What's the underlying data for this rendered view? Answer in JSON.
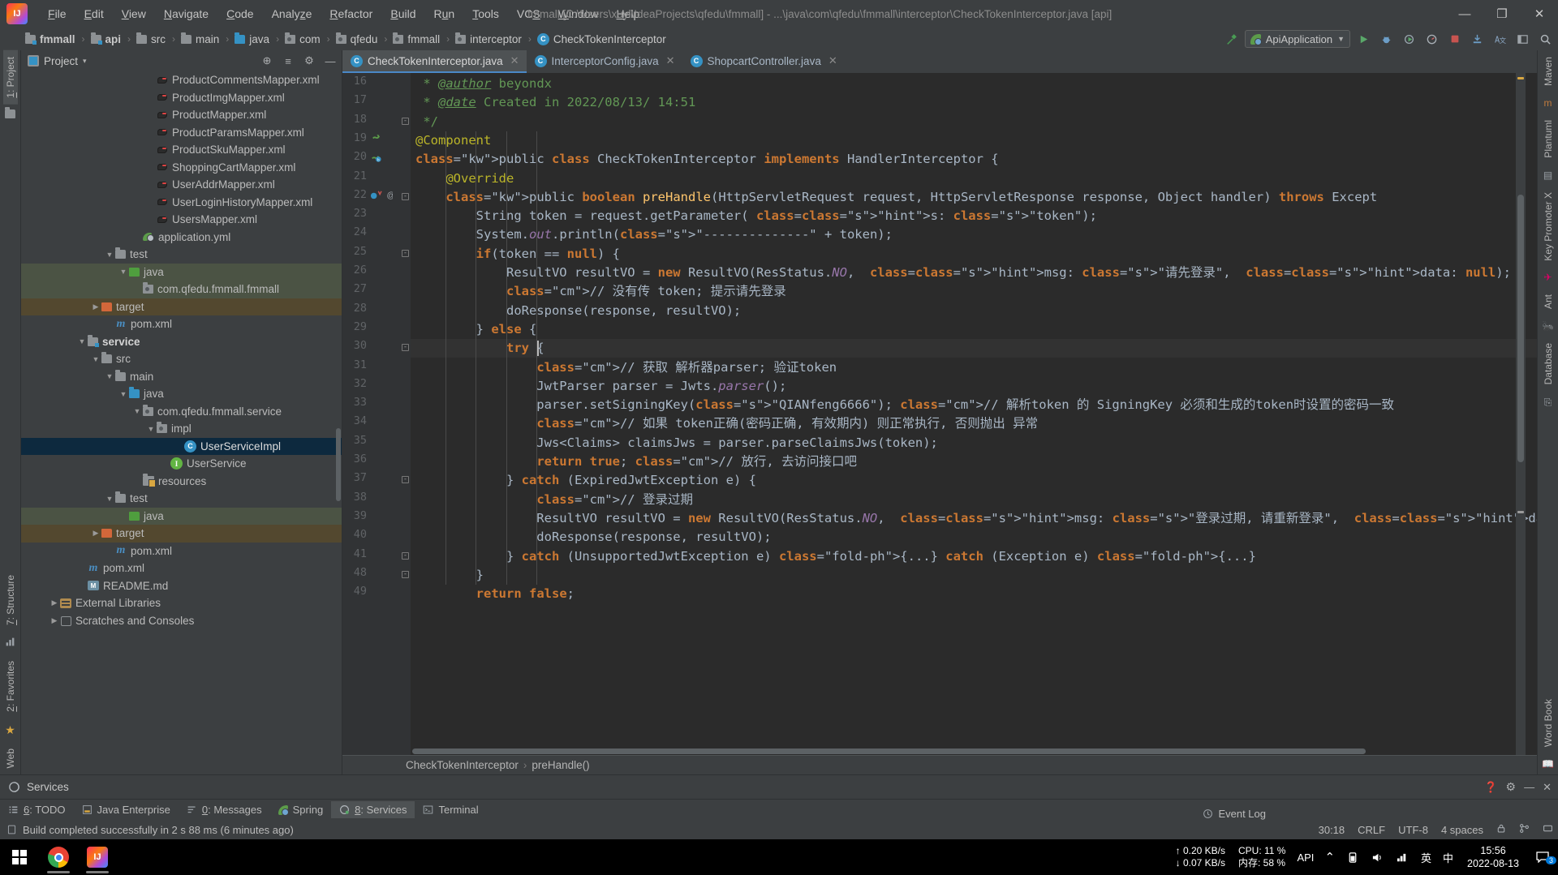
{
  "window": {
    "title": "fmmall [C:\\Users\\xuyl\\IdeaProjects\\qfedu\\fmmall] - ...\\java\\com\\qfedu\\fmmall\\interceptor\\CheckTokenInterceptor.java [api]",
    "minimize": "—",
    "maximize": "❐",
    "close": "✕"
  },
  "menu": {
    "items": [
      "File",
      "Edit",
      "View",
      "Navigate",
      "Code",
      "Analyze",
      "Refactor",
      "Build",
      "Run",
      "Tools",
      "VCS",
      "Window",
      "Help"
    ]
  },
  "navbar": {
    "crumbs": [
      {
        "label": "fmmall",
        "icon": "module-folder-icon",
        "bold": true
      },
      {
        "label": "api",
        "icon": "module-folder-icon",
        "bold": true
      },
      {
        "label": "src",
        "icon": "folder-icon"
      },
      {
        "label": "main",
        "icon": "folder-icon"
      },
      {
        "label": "java",
        "icon": "source-folder-icon"
      },
      {
        "label": "com",
        "icon": "package-icon"
      },
      {
        "label": "qfedu",
        "icon": "package-icon"
      },
      {
        "label": "fmmall",
        "icon": "package-icon"
      },
      {
        "label": "interceptor",
        "icon": "package-icon"
      },
      {
        "label": "CheckTokenInterceptor",
        "icon": "class-icon"
      }
    ],
    "run_config": "ApiApplication",
    "separator": "›"
  },
  "project_panel": {
    "title": "Project",
    "dropdown": "▾",
    "locate_icon": "⊕",
    "collapse_icon": "≡",
    "settings_icon": "⚙",
    "hide_icon": "—",
    "tree": [
      {
        "indent": 9,
        "label": "ProductCommentsMapper.xml",
        "icon": "xml-file-icon",
        "arrow": ""
      },
      {
        "indent": 9,
        "label": "ProductImgMapper.xml",
        "icon": "xml-file-icon",
        "arrow": ""
      },
      {
        "indent": 9,
        "label": "ProductMapper.xml",
        "icon": "xml-file-icon",
        "arrow": ""
      },
      {
        "indent": 9,
        "label": "ProductParamsMapper.xml",
        "icon": "xml-file-icon",
        "arrow": ""
      },
      {
        "indent": 9,
        "label": "ProductSkuMapper.xml",
        "icon": "xml-file-icon",
        "arrow": ""
      },
      {
        "indent": 9,
        "label": "ShoppingCartMapper.xml",
        "icon": "xml-file-icon",
        "arrow": ""
      },
      {
        "indent": 9,
        "label": "UserAddrMapper.xml",
        "icon": "xml-file-icon",
        "arrow": ""
      },
      {
        "indent": 9,
        "label": "UserLoginHistoryMapper.xml",
        "icon": "xml-file-icon",
        "arrow": ""
      },
      {
        "indent": 9,
        "label": "UsersMapper.xml",
        "icon": "xml-file-icon",
        "arrow": ""
      },
      {
        "indent": 8,
        "label": "application.yml",
        "icon": "yml-file-icon",
        "arrow": ""
      },
      {
        "indent": 6,
        "label": "test",
        "icon": "folder-icon",
        "arrow": "▼"
      },
      {
        "indent": 7,
        "label": "java",
        "icon": "test-source-folder-icon",
        "arrow": "▼",
        "row": "green"
      },
      {
        "indent": 8,
        "label": "com.qfedu.fmmall.fmmall",
        "icon": "package-icon",
        "arrow": "",
        "row": "green"
      },
      {
        "indent": 5,
        "label": "target",
        "icon": "target-folder-icon",
        "arrow": "▶",
        "row": "brown"
      },
      {
        "indent": 6,
        "label": "pom.xml",
        "icon": "maven-file-icon",
        "arrow": ""
      },
      {
        "indent": 4,
        "label": "service",
        "icon": "module-folder-icon",
        "arrow": "▼",
        "bold": true
      },
      {
        "indent": 5,
        "label": "src",
        "icon": "folder-icon",
        "arrow": "▼"
      },
      {
        "indent": 6,
        "label": "main",
        "icon": "folder-icon",
        "arrow": "▼"
      },
      {
        "indent": 7,
        "label": "java",
        "icon": "source-folder-icon",
        "arrow": "▼"
      },
      {
        "indent": 8,
        "label": "com.qfedu.fmmall.service",
        "icon": "package-icon",
        "arrow": "▼"
      },
      {
        "indent": 9,
        "label": "impl",
        "icon": "package-icon",
        "arrow": "▼"
      },
      {
        "indent": 11,
        "label": "UserServiceImpl",
        "icon": "class-icon",
        "arrow": "",
        "row": "sel"
      },
      {
        "indent": 10,
        "label": "UserService",
        "icon": "interface-icon",
        "arrow": ""
      },
      {
        "indent": 8,
        "label": "resources",
        "icon": "resources-folder-icon",
        "arrow": ""
      },
      {
        "indent": 6,
        "label": "test",
        "icon": "folder-icon",
        "arrow": "▼"
      },
      {
        "indent": 7,
        "label": "java",
        "icon": "test-source-folder-icon",
        "arrow": "",
        "row": "green"
      },
      {
        "indent": 5,
        "label": "target",
        "icon": "target-folder-icon",
        "arrow": "▶",
        "row": "brown"
      },
      {
        "indent": 6,
        "label": "pom.xml",
        "icon": "maven-file-icon",
        "arrow": ""
      },
      {
        "indent": 4,
        "label": "pom.xml",
        "icon": "maven-file-icon",
        "arrow": ""
      },
      {
        "indent": 4,
        "label": "README.md",
        "icon": "markdown-file-icon",
        "arrow": ""
      },
      {
        "indent": 2,
        "label": "External Libraries",
        "icon": "library-icon",
        "arrow": "▶"
      },
      {
        "indent": 2,
        "label": "Scratches and Consoles",
        "icon": "scratch-icon",
        "arrow": "▶"
      }
    ]
  },
  "left_strip": {
    "tabs": [
      "1: Project",
      "7: Structure",
      "2: Favorites",
      "Web"
    ]
  },
  "right_strip": {
    "tabs": [
      "Maven",
      "Plantuml",
      "Key Promoter X",
      "Ant",
      "Database",
      "Word Book"
    ]
  },
  "editor": {
    "tabs": [
      {
        "label": "CheckTokenInterceptor.java",
        "active": true,
        "icon": "class-icon"
      },
      {
        "label": "InterceptorConfig.java",
        "active": false,
        "icon": "class-icon"
      },
      {
        "label": "ShopcartController.java",
        "active": false,
        "icon": "class-icon"
      }
    ],
    "breadcrumb": [
      "CheckTokenInterceptor",
      "preHandle()"
    ],
    "breadcrumb_sep": "›",
    "line_numbers": [
      16,
      17,
      18,
      19,
      20,
      21,
      22,
      23,
      24,
      25,
      26,
      27,
      28,
      29,
      30,
      31,
      32,
      33,
      34,
      35,
      36,
      37,
      38,
      39,
      40,
      41,
      48,
      49
    ],
    "lines": [
      " * @author beyondx",
      " * @date Created in 2022/08/13/ 14:51",
      " */",
      "@Component",
      "public class CheckTokenInterceptor implements HandlerInterceptor {",
      "    @Override",
      "    public boolean preHandle(HttpServletRequest request, HttpServletResponse response, Object handler) throws Except",
      "        String token = request.getParameter( s: \"token\");",
      "        System.out.println(\"--------------\" + token);",
      "        if(token == null) {",
      "            ResultVO resultVO = new ResultVO(ResStatus.NO,  msg: \"请先登录\",  data: null);",
      "            // 没有传 token; 提示请先登录",
      "            doResponse(response, resultVO);",
      "        } else {",
      "            try {",
      "                // 获取 解析器parser; 验证token",
      "                JwtParser parser = Jwts.parser();",
      "                parser.setSigningKey(\"QIANfeng6666\"); // 解析token 的 SigningKey 必须和生成的token时设置的密码一致",
      "                // 如果 token正确(密码正确, 有效期内) 则正常执行, 否则抛出 异常",
      "                Jws<Claims> claimsJws = parser.parseClaimsJws(token);",
      "                return true; // 放行, 去访问接口吧",
      "            } catch (ExpiredJwtException e) {",
      "                // 登录过期",
      "                ResultVO resultVO = new ResultVO(ResStatus.NO,  msg: \"登录过期, 请重新登录\",  data: null);",
      "                doResponse(response, resultVO);",
      "            } catch (UnsupportedJwtException e) {...} catch (Exception e) {...}",
      "        }",
      "        return false;"
    ]
  },
  "services_panel": {
    "title": "Services",
    "gear": "⚙",
    "help": "❓",
    "minimize": "—",
    "hide": "✕"
  },
  "tool_windows": [
    {
      "label": "6: TODO",
      "icon": "todo-icon",
      "active": false
    },
    {
      "label": "Java Enterprise",
      "icon": "java-enterprise-icon",
      "active": false
    },
    {
      "label": "0: Messages",
      "icon": "messages-icon",
      "active": false
    },
    {
      "label": "Spring",
      "icon": "spring-icon",
      "active": false
    },
    {
      "label": "8: Services",
      "icon": "services-icon",
      "active": true
    },
    {
      "label": "Terminal",
      "icon": "terminal-icon",
      "active": false
    }
  ],
  "status_bar": {
    "message": "Build completed successfully in 2 s 88 ms (6 minutes ago)",
    "caret_position": "30:18",
    "line_separator": "CRLF",
    "encoding": "UTF-8",
    "indent": "4 spaces",
    "lock_icon": "🔒",
    "branch_icon": "⎇"
  },
  "taskbar": {
    "apps": [
      {
        "name": "start-button",
        "icon": "windows-logo-icon"
      },
      {
        "name": "chrome",
        "icon": "chrome-icon"
      },
      {
        "name": "intellij-idea",
        "icon": "intellij-icon",
        "open": true
      }
    ],
    "tray": {
      "upload_speed": "↑ 0.20 KB/s",
      "download_speed": "↓ 0.07 KB/s",
      "cpu": "CPU: 11 %",
      "memory": "内存: 58 %",
      "api_label": "API",
      "chevron": "⌃",
      "ime_lang": "英",
      "ime_cn": "中",
      "time": "15:56",
      "date": "2022-08-13",
      "notification_count": "3"
    }
  },
  "colors": {
    "accent": "#4a88c7",
    "selection": "#0d293e",
    "editor_bg": "#2b2b2b",
    "panel_bg": "#3c3f41",
    "string": "#6a8759",
    "keyword": "#cc7832",
    "comment": "#808080",
    "annotation": "#bbb529"
  }
}
